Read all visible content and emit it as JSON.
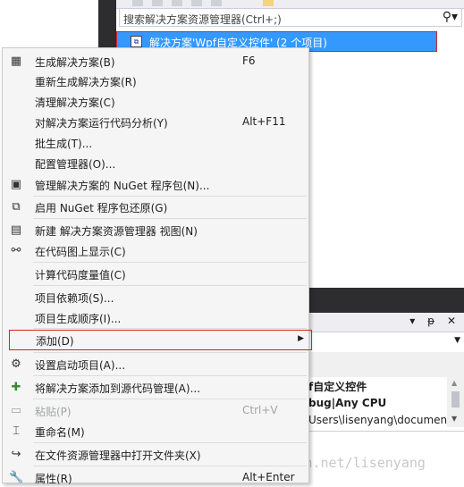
{
  "solution_explorer": {
    "search_placeholder": "搜索解决方案资源管理器(Ctrl+;)",
    "search_icon": "search-icon",
    "selected_item": "解决方案'Wpf自定义控件' (2 个项目)"
  },
  "properties_panel": {
    "title_buttons": "▾ ᵽ ✕",
    "rows": [
      "f自定义控件",
      "bug|Any CPU",
      "Users\\lisenyang\\documen"
    ]
  },
  "context_menu": {
    "items": [
      {
        "label": "生成解决方案(B)",
        "shortcut": "F6",
        "icon": "build-icon"
      },
      {
        "label": "重新生成解决方案(R)",
        "shortcut": "",
        "icon": ""
      },
      {
        "label": "清理解决方案(C)",
        "shortcut": "",
        "icon": ""
      },
      {
        "label": "对解决方案运行代码分析(Y)",
        "shortcut": "Alt+F11",
        "icon": ""
      },
      {
        "label": "批生成(T)...",
        "shortcut": "",
        "icon": ""
      },
      {
        "label": "配置管理器(O)...",
        "shortcut": "",
        "icon": ""
      },
      {
        "label": "管理解决方案的 NuGet 程序包(N)...",
        "shortcut": "",
        "icon": "nuget-icon"
      },
      {
        "label": "启用 NuGet 程序包还原(G)",
        "shortcut": "",
        "icon": "package-restore-icon"
      },
      {
        "label": "新建 解决方案资源管理器 视图(N)",
        "shortcut": "",
        "icon": "new-view-icon"
      },
      {
        "label": "在代码图上显示(C)",
        "shortcut": "",
        "icon": "code-map-icon"
      },
      {
        "label": "计算代码度量值(C)",
        "shortcut": "",
        "icon": ""
      },
      {
        "label": "项目依赖项(S)...",
        "shortcut": "",
        "icon": ""
      },
      {
        "label": "项目生成顺序(I)...",
        "shortcut": "",
        "icon": ""
      },
      {
        "label": "添加(D)",
        "shortcut": "",
        "icon": ""
      },
      {
        "label": "设置启动项目(A)...",
        "shortcut": "",
        "icon": "gear-icon"
      },
      {
        "label": "将解决方案添加到源代码管理(A)...",
        "shortcut": "",
        "icon": "source-control-icon"
      },
      {
        "label": "粘贴(P)",
        "shortcut": "Ctrl+V",
        "icon": "paste-icon"
      },
      {
        "label": "重命名(M)",
        "shortcut": "",
        "icon": "rename-icon"
      },
      {
        "label": "在文件资源管理器中打开文件夹(X)",
        "shortcut": "",
        "icon": "open-folder-icon"
      },
      {
        "label": "属性(R)",
        "shortcut": "Alt+Enter",
        "icon": "wrench-icon"
      }
    ]
  },
  "watermark": "http://blog.csdn.net/lisenyang",
  "colors": {
    "selection": "#3399ff",
    "highlight_border": "#d3232c",
    "menu_bg": "#f5f5f5"
  }
}
